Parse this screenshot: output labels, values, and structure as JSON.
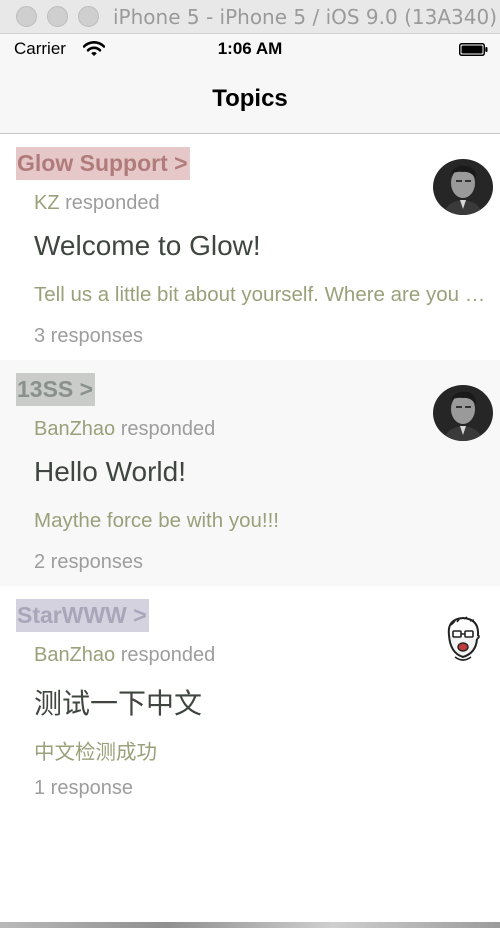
{
  "window": {
    "title": "iPhone 5 - iPhone 5 / iOS 9.0 (13A340)"
  },
  "status_bar": {
    "carrier": "Carrier",
    "time": "1:06 AM",
    "wifi_icon": "wifi-icon",
    "battery_icon": "battery-icon"
  },
  "nav": {
    "title": "Topics"
  },
  "topics": [
    {
      "group": "Glow Support >",
      "group_bg": "#e6c8c8",
      "group_color": "#b07b7b",
      "author": "KZ",
      "verb": "responded",
      "title": "Welcome to Glow!",
      "excerpt": "Tell us a little bit about yourself. Where are you from?",
      "responses": "3 responses",
      "avatar_icon": "user-photo-icon"
    },
    {
      "group": "13SS >",
      "group_bg": "#c9ccc9",
      "group_color": "#8a908a",
      "author": "BanZhao",
      "verb": "responded",
      "title": "Hello World!",
      "excerpt": "Maythe force be with you!!!",
      "responses": "2 responses",
      "avatar_icon": "user-photo-icon"
    },
    {
      "group": "StarWWW >",
      "group_bg": "#d4d2de",
      "group_color": "#a8a6b8",
      "author": "BanZhao",
      "verb": "responded",
      "title": "测试一下中文",
      "excerpt": "中文检测成功",
      "responses": "1 response",
      "avatar_icon": "cartoon-face-icon"
    }
  ],
  "colors": {
    "author": "#9aa07a",
    "muted": "#9d9d9d",
    "title": "#3f463f",
    "alt_row": "#f8f8f8"
  }
}
